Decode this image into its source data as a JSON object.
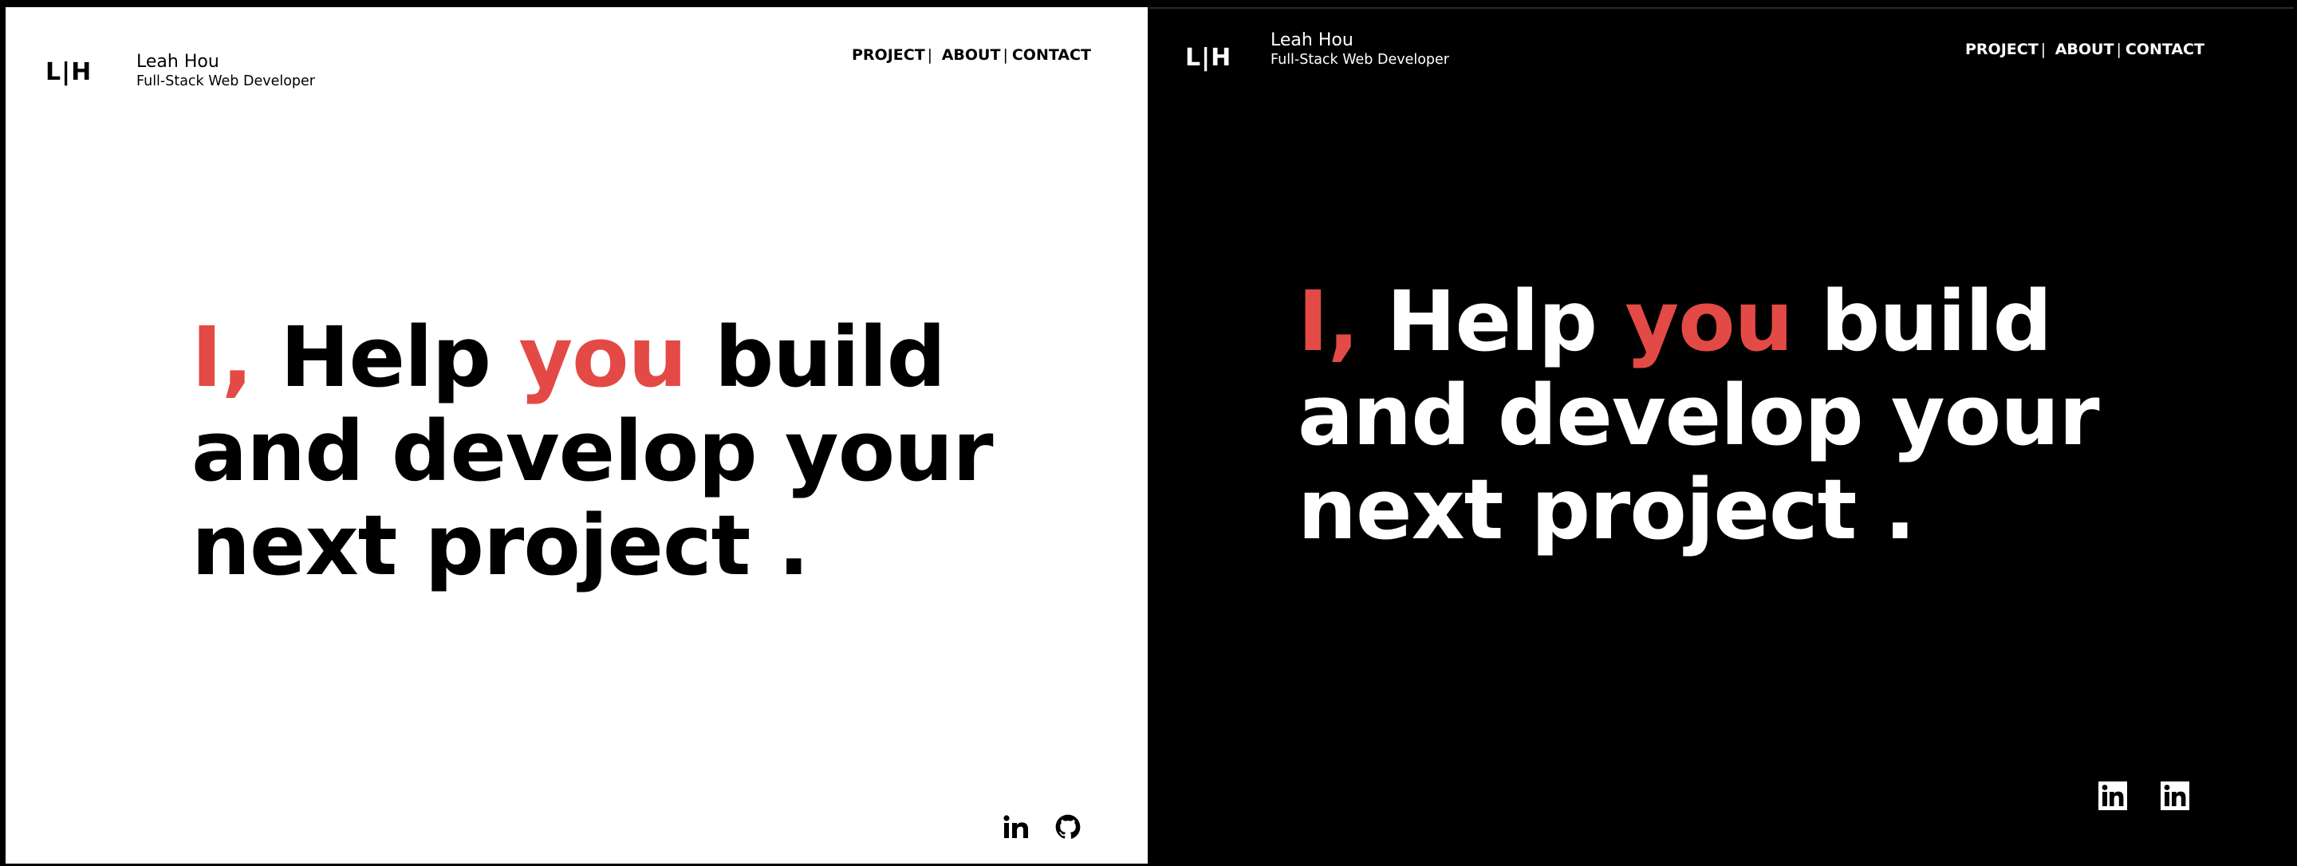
{
  "brand": {
    "logo_left": "L",
    "logo_bar": "|",
    "logo_right": "H",
    "name": "Leah Hou",
    "role": "Full-Stack Web Developer"
  },
  "nav": {
    "project": "PROJECT",
    "about": "ABOUT",
    "contact": "CONTACT",
    "separator": "|"
  },
  "hero": {
    "first_word": "I,",
    "help": "Help",
    "you": "you",
    "build": "build",
    "line2": "and develop your",
    "line3": "next project ."
  },
  "social": {
    "light_icons": [
      "linkedin-icon",
      "github-icon"
    ],
    "dark_icons": [
      "linkedin-icon",
      "linkedin-icon"
    ]
  },
  "colors": {
    "accent": "#e34a45",
    "light_bg": "#ffffff",
    "dark_bg": "#000000"
  }
}
